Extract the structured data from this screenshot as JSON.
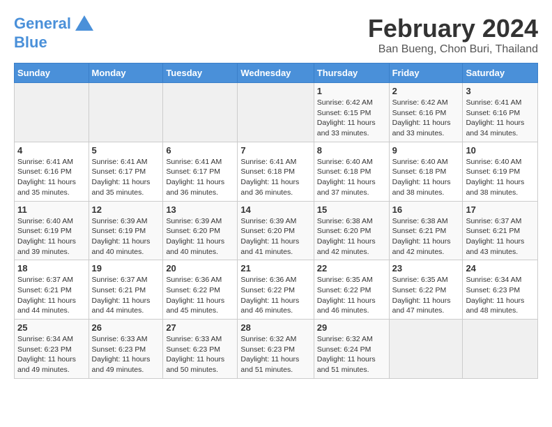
{
  "header": {
    "logo_line1": "General",
    "logo_line2": "Blue",
    "month": "February 2024",
    "location": "Ban Bueng, Chon Buri, Thailand"
  },
  "days_of_week": [
    "Sunday",
    "Monday",
    "Tuesday",
    "Wednesday",
    "Thursday",
    "Friday",
    "Saturday"
  ],
  "weeks": [
    [
      {
        "day": "",
        "info": ""
      },
      {
        "day": "",
        "info": ""
      },
      {
        "day": "",
        "info": ""
      },
      {
        "day": "",
        "info": ""
      },
      {
        "day": "1",
        "sunrise": "6:42 AM",
        "sunset": "6:15 PM",
        "daylight": "11 hours and 33 minutes."
      },
      {
        "day": "2",
        "sunrise": "6:42 AM",
        "sunset": "6:16 PM",
        "daylight": "11 hours and 33 minutes."
      },
      {
        "day": "3",
        "sunrise": "6:41 AM",
        "sunset": "6:16 PM",
        "daylight": "11 hours and 34 minutes."
      }
    ],
    [
      {
        "day": "4",
        "sunrise": "6:41 AM",
        "sunset": "6:16 PM",
        "daylight": "11 hours and 35 minutes."
      },
      {
        "day": "5",
        "sunrise": "6:41 AM",
        "sunset": "6:17 PM",
        "daylight": "11 hours and 35 minutes."
      },
      {
        "day": "6",
        "sunrise": "6:41 AM",
        "sunset": "6:17 PM",
        "daylight": "11 hours and 36 minutes."
      },
      {
        "day": "7",
        "sunrise": "6:41 AM",
        "sunset": "6:18 PM",
        "daylight": "11 hours and 36 minutes."
      },
      {
        "day": "8",
        "sunrise": "6:40 AM",
        "sunset": "6:18 PM",
        "daylight": "11 hours and 37 minutes."
      },
      {
        "day": "9",
        "sunrise": "6:40 AM",
        "sunset": "6:18 PM",
        "daylight": "11 hours and 38 minutes."
      },
      {
        "day": "10",
        "sunrise": "6:40 AM",
        "sunset": "6:19 PM",
        "daylight": "11 hours and 38 minutes."
      }
    ],
    [
      {
        "day": "11",
        "sunrise": "6:40 AM",
        "sunset": "6:19 PM",
        "daylight": "11 hours and 39 minutes."
      },
      {
        "day": "12",
        "sunrise": "6:39 AM",
        "sunset": "6:19 PM",
        "daylight": "11 hours and 40 minutes."
      },
      {
        "day": "13",
        "sunrise": "6:39 AM",
        "sunset": "6:20 PM",
        "daylight": "11 hours and 40 minutes."
      },
      {
        "day": "14",
        "sunrise": "6:39 AM",
        "sunset": "6:20 PM",
        "daylight": "11 hours and 41 minutes."
      },
      {
        "day": "15",
        "sunrise": "6:38 AM",
        "sunset": "6:20 PM",
        "daylight": "11 hours and 42 minutes."
      },
      {
        "day": "16",
        "sunrise": "6:38 AM",
        "sunset": "6:21 PM",
        "daylight": "11 hours and 42 minutes."
      },
      {
        "day": "17",
        "sunrise": "6:37 AM",
        "sunset": "6:21 PM",
        "daylight": "11 hours and 43 minutes."
      }
    ],
    [
      {
        "day": "18",
        "sunrise": "6:37 AM",
        "sunset": "6:21 PM",
        "daylight": "11 hours and 44 minutes."
      },
      {
        "day": "19",
        "sunrise": "6:37 AM",
        "sunset": "6:21 PM",
        "daylight": "11 hours and 44 minutes."
      },
      {
        "day": "20",
        "sunrise": "6:36 AM",
        "sunset": "6:22 PM",
        "daylight": "11 hours and 45 minutes."
      },
      {
        "day": "21",
        "sunrise": "6:36 AM",
        "sunset": "6:22 PM",
        "daylight": "11 hours and 46 minutes."
      },
      {
        "day": "22",
        "sunrise": "6:35 AM",
        "sunset": "6:22 PM",
        "daylight": "11 hours and 46 minutes."
      },
      {
        "day": "23",
        "sunrise": "6:35 AM",
        "sunset": "6:22 PM",
        "daylight": "11 hours and 47 minutes."
      },
      {
        "day": "24",
        "sunrise": "6:34 AM",
        "sunset": "6:23 PM",
        "daylight": "11 hours and 48 minutes."
      }
    ],
    [
      {
        "day": "25",
        "sunrise": "6:34 AM",
        "sunset": "6:23 PM",
        "daylight": "11 hours and 49 minutes."
      },
      {
        "day": "26",
        "sunrise": "6:33 AM",
        "sunset": "6:23 PM",
        "daylight": "11 hours and 49 minutes."
      },
      {
        "day": "27",
        "sunrise": "6:33 AM",
        "sunset": "6:23 PM",
        "daylight": "11 hours and 50 minutes."
      },
      {
        "day": "28",
        "sunrise": "6:32 AM",
        "sunset": "6:23 PM",
        "daylight": "11 hours and 51 minutes."
      },
      {
        "day": "29",
        "sunrise": "6:32 AM",
        "sunset": "6:24 PM",
        "daylight": "11 hours and 51 minutes."
      },
      {
        "day": "",
        "info": ""
      },
      {
        "day": "",
        "info": ""
      }
    ]
  ],
  "labels": {
    "sunrise_prefix": "Sunrise: ",
    "sunset_prefix": "Sunset: ",
    "daylight_prefix": "Daylight: "
  }
}
